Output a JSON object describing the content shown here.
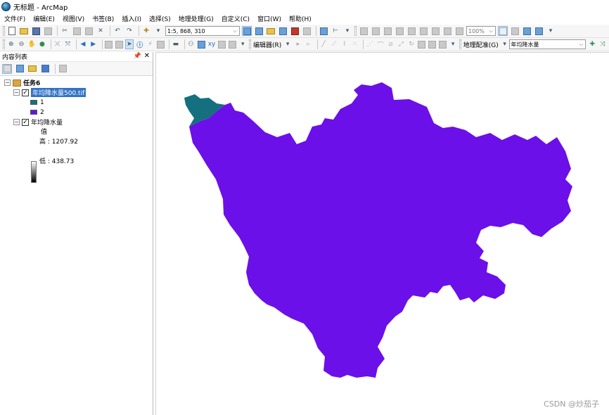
{
  "window": {
    "title": "无标题 - ArcMap"
  },
  "menu": [
    "文件(F)",
    "编辑(E)",
    "视图(V)",
    "书签(B)",
    "插入(I)",
    "选择(S)",
    "地理处理(G)",
    "自定义(C)",
    "窗口(W)",
    "帮助(H)"
  ],
  "toolbar": {
    "scale_value": "1:5, 868, 310",
    "zoom_value": "100%",
    "editor_label": "编辑器(R)",
    "georef_label": "地理配准(G)",
    "georef_layer": "年均降水量"
  },
  "toc": {
    "title": "内容列表",
    "pin_icon": "pin-icon",
    "close_label": "✕",
    "data_frame": "任务6",
    "layer1": {
      "name": "年均降水量500.tif",
      "classes": [
        {
          "label": "1",
          "color": "#14707f"
        },
        {
          "label": "2",
          "color": "#6b10e8"
        }
      ]
    },
    "layer2": {
      "name": "年均降水量",
      "value_header": "值",
      "high_label": "高 : 1207.92",
      "low_label": "低 : 438.73"
    }
  },
  "map": {
    "fill_main": "#6b10e8",
    "fill_class1": "#14707f"
  },
  "watermark": "CSDN @炒茄子"
}
